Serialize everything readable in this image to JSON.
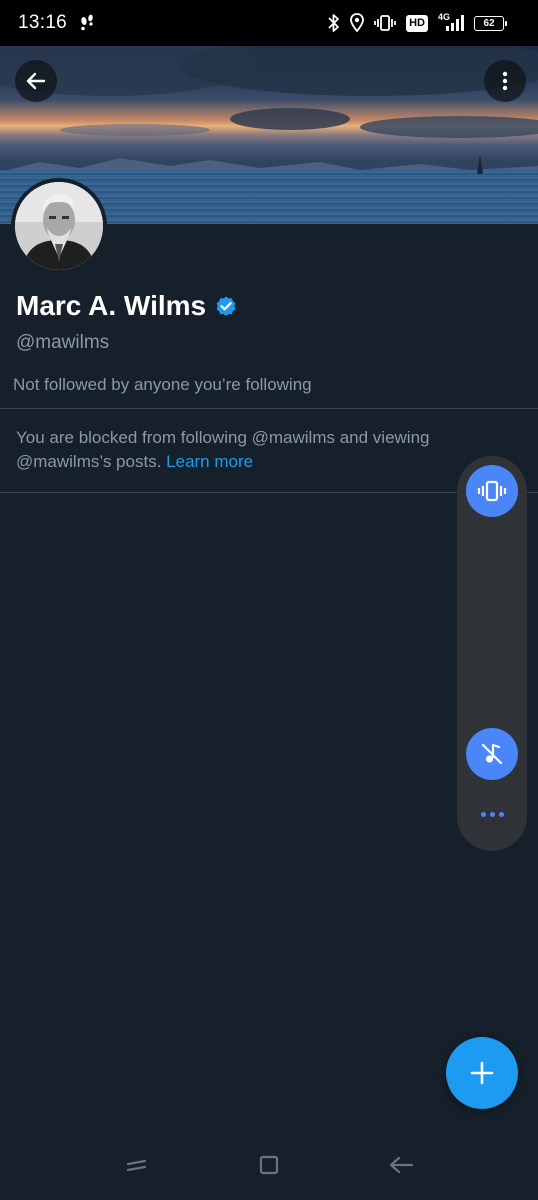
{
  "status_bar": {
    "time": "13:16",
    "hd_label": "HD",
    "network_label": "4G",
    "battery_level": "62",
    "icons": [
      "footsteps-icon",
      "bluetooth-icon",
      "location-icon",
      "vibrate-icon",
      "hd-icon",
      "signal-icon",
      "battery-icon"
    ]
  },
  "header": {
    "back_icon": "arrow-left-icon",
    "more_icon": "more-vertical-icon"
  },
  "profile": {
    "name": "Marc A. Wilms",
    "handle": "@mawilms",
    "verified": true,
    "followers_note": "Not followed by anyone you’re following"
  },
  "blocked_notice": {
    "text": "You are blocked from following @mawilms and viewing @mawilms’s posts.",
    "link_label": "Learn more"
  },
  "sound_panel": {
    "top_button_icon": "vibrate-icon",
    "bottom_button_icon": "music-off-icon",
    "more_icon": "more-horizontal-icon"
  },
  "fab": {
    "icon": "plus-icon"
  },
  "nav_bar": {
    "icons": [
      "recents-icon",
      "home-icon",
      "back-icon"
    ]
  },
  "colors": {
    "background": "#15202b",
    "accent": "#1d9bf0",
    "secondary_text": "#8b98a5",
    "panel_button": "#4a86f7"
  }
}
